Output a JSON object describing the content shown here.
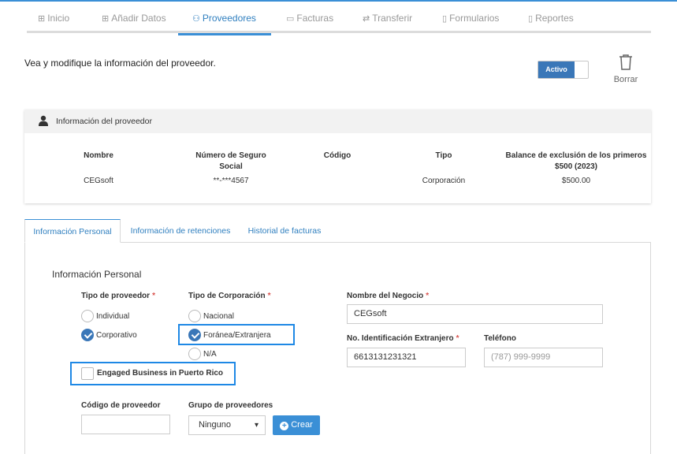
{
  "nav": {
    "items": [
      {
        "label": "Inicio",
        "icon": "grid-icon"
      },
      {
        "label": "Añadir Datos",
        "icon": "plus-square-icon"
      },
      {
        "label": "Proveedores",
        "icon": "users-icon"
      },
      {
        "label": "Facturas",
        "icon": "invoice-icon"
      },
      {
        "label": "Transferir",
        "icon": "arrows-icon"
      },
      {
        "label": "Formularios",
        "icon": "document-icon"
      },
      {
        "label": "Reportes",
        "icon": "clipboard-icon"
      }
    ],
    "active": "Proveedores"
  },
  "description": "Vea y modifique la información del proveedor.",
  "status_toggle": {
    "label": "Activo",
    "state": "on"
  },
  "delete": {
    "label": "Borrar"
  },
  "provider_card": {
    "title": "Información del proveedor",
    "headers": {
      "nombre": "Nombre",
      "ssn": "Número de Seguro Social",
      "codigo": "Código",
      "tipo": "Tipo",
      "balance": "Balance de exclusión de los primeros $500 (2023)"
    },
    "values": {
      "nombre": "CEGsoft",
      "ssn": "**-***4567",
      "codigo": "",
      "tipo": "Corporación",
      "balance": "$500.00"
    }
  },
  "tabs": [
    {
      "label": "Información Personal",
      "active": true
    },
    {
      "label": "Información de retenciones",
      "active": false
    },
    {
      "label": "Historial de facturas",
      "active": false
    }
  ],
  "form": {
    "section_title": "Información Personal",
    "tipo_proveedor": {
      "label": "Tipo de proveedor",
      "options": [
        "Individual",
        "Corporativo"
      ],
      "selected": "Corporativo"
    },
    "tipo_corporacion": {
      "label": "Tipo de Corporación",
      "options": [
        "Nacional",
        "Foránea/Extranjera",
        "N/A"
      ],
      "selected": "Foránea/Extranjera"
    },
    "engaged_business": {
      "label": "Engaged Business in Puerto Rico",
      "checked": false
    },
    "nombre_negocio": {
      "label": "Nombre del Negocio",
      "value": "CEGsoft"
    },
    "id_extranjero": {
      "label": "No. Identificación Extranjero",
      "value": "6613131231321"
    },
    "telefono": {
      "label": "Teléfono",
      "placeholder": "(787) 999-9999"
    },
    "codigo_proveedor": {
      "label": "Código de proveedor",
      "value": ""
    },
    "grupo_proveedores": {
      "label": "Grupo de proveedores",
      "selected": "Ninguno"
    },
    "crear_button": "Crear",
    "required_mark": "*"
  },
  "colors": {
    "accent": "#3a8fd6",
    "highlight": "#1e88e5",
    "required": "#d9534f"
  }
}
